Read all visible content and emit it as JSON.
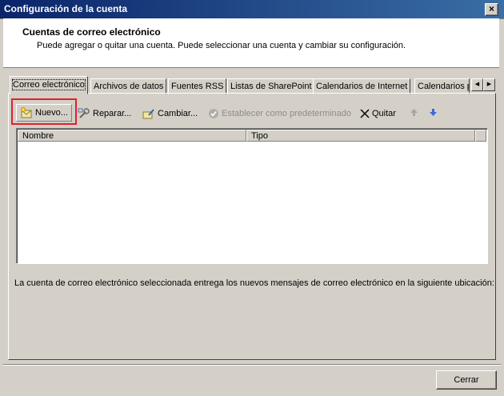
{
  "window": {
    "title": "Configuración de la cuenta",
    "close_glyph": "×"
  },
  "header": {
    "title": "Cuentas de correo electrónico",
    "subtitle": "Puede agregar o quitar una cuenta. Puede seleccionar una cuenta y cambiar su configuración."
  },
  "tabs": [
    {
      "label": "Correo electrónico",
      "active": true
    },
    {
      "label": "Archivos de datos"
    },
    {
      "label": "Fuentes RSS"
    },
    {
      "label": "Listas de SharePoint"
    },
    {
      "label": "Calendarios de Internet"
    },
    {
      "label": "Calendarios p"
    }
  ],
  "toolbar": {
    "new": "Nuevo...",
    "repair": "Reparar...",
    "change": "Cambiar...",
    "set_default": "Establecer como predeterminado",
    "remove": "Quitar"
  },
  "list": {
    "columns": [
      "Nombre",
      "Tipo"
    ]
  },
  "info_text": "La cuenta de correo electrónico seleccionada entrega los nuevos mensajes de correo electrónico en la siguiente ubicación:",
  "footer": {
    "close": "Cerrar"
  },
  "colors": {
    "title_bar": "#0a246a",
    "highlight": "#e0202a",
    "dialog": "#d4d0c8"
  }
}
